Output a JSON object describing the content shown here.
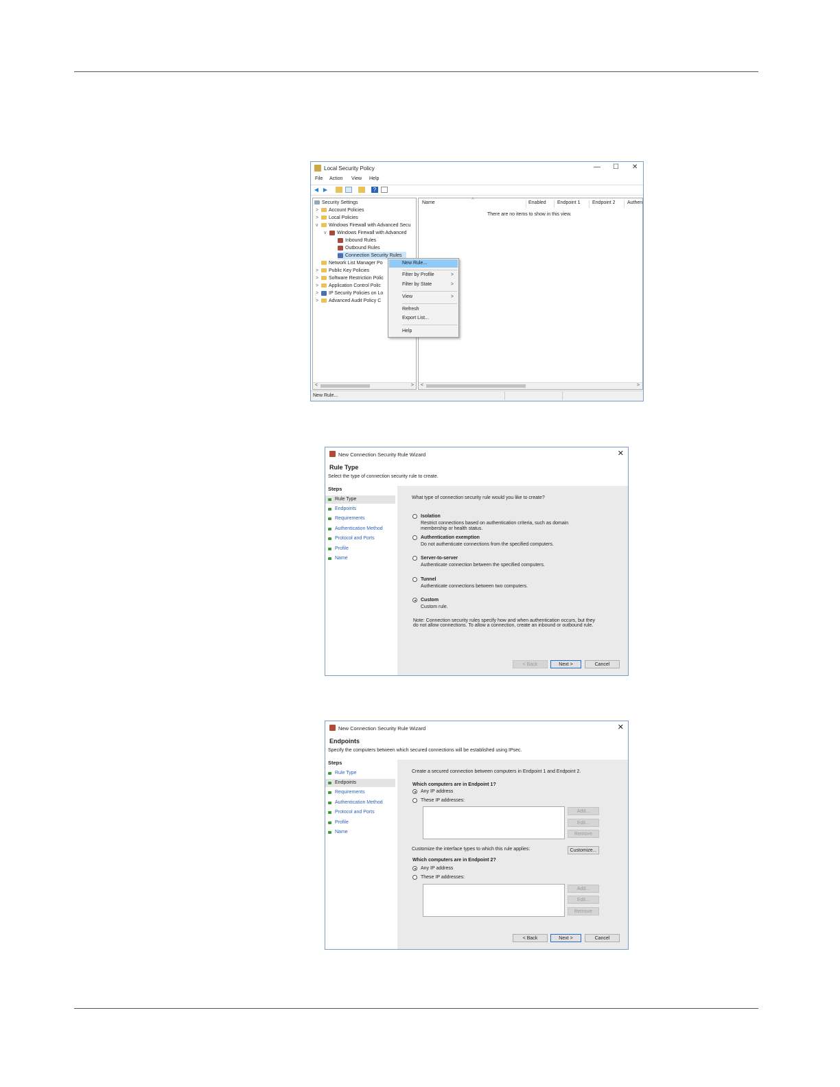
{
  "lsp": {
    "title": "Local Security Policy",
    "menu": [
      "File",
      "Action",
      "View",
      "Help"
    ],
    "tree": [
      {
        "label": "Security Settings",
        "chevron": ""
      },
      {
        "label": "Account Policies",
        "chevron": ">"
      },
      {
        "label": "Local Policies",
        "chevron": ">"
      },
      {
        "label": "Windows Firewall with Advanced Secu",
        "chevron": "v"
      },
      {
        "label": "Windows Firewall with Advanced",
        "chevron": "v"
      },
      {
        "label": "Inbound Rules",
        "chevron": ""
      },
      {
        "label": "Outbound Rules",
        "chevron": ""
      },
      {
        "label": "Connection Security Rules",
        "chevron": ""
      },
      {
        "label": "Network List Manager Po",
        "chevron": ""
      },
      {
        "label": "Public Key Policies",
        "chevron": ">"
      },
      {
        "label": "Software Restriction Polic",
        "chevron": ">"
      },
      {
        "label": "Application Control Polic",
        "chevron": ">"
      },
      {
        "label": "IP Security Policies on Lo",
        "chevron": ">"
      },
      {
        "label": "Advanced Audit Policy C",
        "chevron": ">"
      }
    ],
    "columns": [
      "Name",
      "Enabled",
      "Endpoint 1",
      "Endpoint 2",
      "Authen"
    ],
    "empty_text": "There are no items to show in this view.",
    "status": "New Rule...",
    "context_menu": [
      {
        "label": "New Rule...",
        "submenu": ""
      },
      {
        "label": "Filter by Profile",
        "submenu": ">"
      },
      {
        "label": "Filter by State",
        "submenu": ">"
      },
      {
        "label": "View",
        "submenu": ">"
      },
      {
        "label": "Refresh",
        "submenu": ""
      },
      {
        "label": "Export List...",
        "submenu": ""
      },
      {
        "label": "Help",
        "submenu": ""
      }
    ]
  },
  "wizard1": {
    "title": "New Connection Security Rule Wizard",
    "page_title": "Rule Type",
    "page_desc": "Select the type of connection security rule to create.",
    "steps_header": "Steps",
    "steps": [
      "Rule Type",
      "Endpoints",
      "Requirements",
      "Authentication Method",
      "Protocol and Ports",
      "Profile",
      "Name"
    ],
    "question": "What type of connection security rule would you like to create?",
    "options": [
      {
        "label": "Isolation",
        "desc": "Restrict connections based on authentication criteria, such as domain",
        "desc2": "membership or health status."
      },
      {
        "label": "Authentication exemption",
        "desc": "Do not authenticate connections from the specified computers.",
        "desc2": ""
      },
      {
        "label": "Server-to-server",
        "desc": "Authenticate connection between the specified computers.",
        "desc2": ""
      },
      {
        "label": "Tunnel",
        "desc": "Authenticate connections between two computers.",
        "desc2": ""
      },
      {
        "label": "Custom",
        "desc": "Custom rule.",
        "desc2": ""
      }
    ],
    "note1": "Note:  Connection security rules specify how and when authentication occurs, but they",
    "note2": "do not allow connections.  To allow a connection, create an inbound or outbound rule.",
    "back": "< Back",
    "next": "Next >",
    "cancel": "Cancel"
  },
  "wizard2": {
    "title": "New Connection Security Rule Wizard",
    "page_title": "Endpoints",
    "page_desc": "Specify the computers between which secured connections will be established using IPsec.",
    "steps_header": "Steps",
    "steps": [
      "Rule Type",
      "Endpoints",
      "Requirements",
      "Authentication Method",
      "Protocol and Ports",
      "Profile",
      "Name"
    ],
    "intro": "Create a secured connection between computers in Endpoint 1 and Endpoint 2.",
    "ep1_question": "Which computers are in Endpoint 1?",
    "ep2_question": "Which computers are in Endpoint 2?",
    "any_ip": "Any IP address",
    "these_ip": "These IP addresses:",
    "add": "Add...",
    "edit": "Edit...",
    "remove": "Remove",
    "customize_text": "Customize the interface types to which this rule applies:",
    "customize": "Customize...",
    "back": "< Back",
    "next": "Next >",
    "cancel": "Cancel"
  }
}
